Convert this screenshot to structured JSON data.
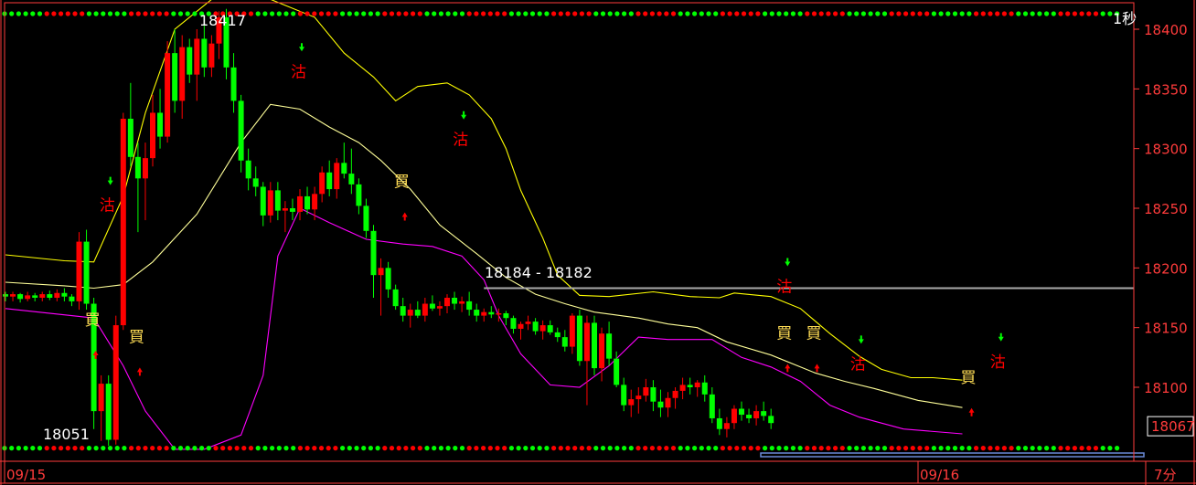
{
  "chart_data": {
    "type": "candlestick",
    "title": "",
    "period_label": "7分",
    "corner_label": "1秒",
    "y_ticks": [
      18400,
      18350,
      18300,
      18250,
      18200,
      18150,
      18100
    ],
    "ylim": [
      18045,
      18430
    ],
    "date_labels": [
      {
        "label": "09/15",
        "index": 0
      },
      {
        "label": "09/16",
        "index": 96
      }
    ],
    "current_price": "18067",
    "high_label": "18417",
    "low_label": "18051",
    "range_label": "18184 - 18182",
    "range_level": 18183,
    "top_dotted_level": 18413,
    "bottom_dotted_level": 18049,
    "colors": {
      "up": "#ff0000",
      "down": "#00ff00",
      "axis": "#ff3b3b",
      "upper_band": "#ffff00",
      "middle_band": "#ffff99",
      "lower_band": "#ff00ff",
      "hline": "#aaaaaa",
      "bottom_bar": "#6a8ad8"
    },
    "candles": [
      [
        18178,
        18180,
        18172,
        18176
      ],
      [
        18176,
        18180,
        18172,
        18178
      ],
      [
        18178,
        18179,
        18171,
        18174
      ],
      [
        18174,
        18180,
        18172,
        18177
      ],
      [
        18177,
        18179,
        18172,
        18175
      ],
      [
        18175,
        18180,
        18172,
        18178
      ],
      [
        18178,
        18181,
        18173,
        18175
      ],
      [
        18175,
        18182,
        18172,
        18179
      ],
      [
        18179,
        18183,
        18172,
        18176
      ],
      [
        18176,
        18178,
        18168,
        18172
      ],
      [
        18172,
        18230,
        18165,
        18222
      ],
      [
        18222,
        18232,
        18165,
        18170
      ],
      [
        18170,
        18175,
        18065,
        18080
      ],
      [
        18080,
        18110,
        18055,
        18103
      ],
      [
        18103,
        18110,
        18051,
        18056
      ],
      [
        18056,
        18160,
        18052,
        18152
      ],
      [
        18152,
        18330,
        18148,
        18325
      ],
      [
        18325,
        18355,
        18285,
        18293
      ],
      [
        18293,
        18305,
        18230,
        18275
      ],
      [
        18275,
        18305,
        18240,
        18292
      ],
      [
        18292,
        18345,
        18285,
        18330
      ],
      [
        18330,
        18350,
        18300,
        18310
      ],
      [
        18310,
        18390,
        18305,
        18380
      ],
      [
        18380,
        18400,
        18330,
        18340
      ],
      [
        18340,
        18395,
        18325,
        18385
      ],
      [
        18385,
        18392,
        18355,
        18362
      ],
      [
        18362,
        18400,
        18340,
        18392
      ],
      [
        18392,
        18405,
        18360,
        18368
      ],
      [
        18368,
        18395,
        18360,
        18388
      ],
      [
        18388,
        18415,
        18375,
        18410
      ],
      [
        18410,
        18417,
        18358,
        18368
      ],
      [
        18368,
        18380,
        18330,
        18340
      ],
      [
        18340,
        18345,
        18280,
        18290
      ],
      [
        18290,
        18300,
        18265,
        18275
      ],
      [
        18275,
        18285,
        18260,
        18268
      ],
      [
        18268,
        18272,
        18235,
        18244
      ],
      [
        18244,
        18272,
        18238,
        18265
      ],
      [
        18265,
        18272,
        18240,
        18248
      ],
      [
        18248,
        18256,
        18230,
        18250
      ],
      [
        18250,
        18258,
        18240,
        18247
      ],
      [
        18247,
        18266,
        18240,
        18260
      ],
      [
        18260,
        18268,
        18245,
        18249
      ],
      [
        18249,
        18268,
        18240,
        18262
      ],
      [
        18262,
        18285,
        18255,
        18280
      ],
      [
        18280,
        18290,
        18260,
        18266
      ],
      [
        18266,
        18292,
        18258,
        18288
      ],
      [
        18288,
        18305,
        18275,
        18279
      ],
      [
        18279,
        18300,
        18262,
        18270
      ],
      [
        18270,
        18275,
        18245,
        18252
      ],
      [
        18252,
        18258,
        18225,
        18231
      ],
      [
        18231,
        18236,
        18175,
        18194
      ],
      [
        18194,
        18208,
        18160,
        18200
      ],
      [
        18200,
        18205,
        18175,
        18182
      ],
      [
        18182,
        18186,
        18165,
        18168
      ],
      [
        18168,
        18175,
        18155,
        18160
      ],
      [
        18160,
        18170,
        18150,
        18165
      ],
      [
        18165,
        18172,
        18158,
        18160
      ],
      [
        18160,
        18175,
        18155,
        18170
      ],
      [
        18170,
        18177,
        18164,
        18166
      ],
      [
        18166,
        18172,
        18160,
        18168
      ],
      [
        18168,
        18178,
        18162,
        18175
      ],
      [
        18175,
        18180,
        18165,
        18170
      ],
      [
        18170,
        18176,
        18163,
        18172
      ],
      [
        18172,
        18180,
        18160,
        18165
      ],
      [
        18165,
        18170,
        18155,
        18160
      ],
      [
        18160,
        18166,
        18155,
        18163
      ],
      [
        18163,
        18168,
        18158,
        18161
      ],
      [
        18161,
        18166,
        18155,
        18162
      ],
      [
        18162,
        18164,
        18152,
        18158
      ],
      [
        18158,
        18160,
        18145,
        18149
      ],
      [
        18149,
        18155,
        18140,
        18153
      ],
      [
        18153,
        18160,
        18148,
        18155
      ],
      [
        18155,
        18158,
        18144,
        18147
      ],
      [
        18147,
        18156,
        18140,
        18152
      ],
      [
        18152,
        18156,
        18144,
        18146
      ],
      [
        18146,
        18150,
        18138,
        18142
      ],
      [
        18142,
        18148,
        18130,
        18134
      ],
      [
        18134,
        18162,
        18128,
        18160
      ],
      [
        18160,
        18165,
        18118,
        18122
      ],
      [
        18122,
        18160,
        18085,
        18154
      ],
      [
        18154,
        18160,
        18110,
        18116
      ],
      [
        18116,
        18150,
        18105,
        18145
      ],
      [
        18145,
        18155,
        18118,
        18124
      ],
      [
        18124,
        18130,
        18100,
        18102
      ],
      [
        18102,
        18108,
        18080,
        18085
      ],
      [
        18085,
        18098,
        18075,
        18090
      ],
      [
        18090,
        18100,
        18078,
        18093
      ],
      [
        18093,
        18107,
        18088,
        18100
      ],
      [
        18100,
        18106,
        18080,
        18088
      ],
      [
        18088,
        18098,
        18075,
        18083
      ],
      [
        18083,
        18096,
        18075,
        18091
      ],
      [
        18091,
        18100,
        18082,
        18097
      ],
      [
        18097,
        18108,
        18090,
        18102
      ],
      [
        18102,
        18108,
        18094,
        18100
      ],
      [
        18100,
        18106,
        18092,
        18104
      ],
      [
        18104,
        18110,
        18088,
        18094
      ],
      [
        18094,
        18100,
        18070,
        18074
      ],
      [
        18074,
        18082,
        18060,
        18065
      ],
      [
        18065,
        18075,
        18058,
        18070
      ],
      [
        18070,
        18085,
        18065,
        18082
      ],
      [
        18082,
        18088,
        18072,
        18077
      ],
      [
        18077,
        18082,
        18070,
        18074
      ],
      [
        18074,
        18085,
        18068,
        18080
      ],
      [
        18080,
        18088,
        18072,
        18076
      ],
      [
        18076,
        18082,
        18065,
        18070
      ]
    ],
    "bands": {
      "upper": [
        [
          0,
          18211
        ],
        [
          8,
          18206
        ],
        [
          12,
          18205
        ],
        [
          16,
          18260
        ],
        [
          19,
          18330
        ],
        [
          23,
          18400
        ],
        [
          29,
          18430
        ],
        [
          36,
          18425
        ],
        [
          42,
          18410
        ],
        [
          46,
          18380
        ],
        [
          50,
          18360
        ],
        [
          53,
          18340
        ],
        [
          56,
          18352
        ],
        [
          60,
          18355
        ],
        [
          63,
          18345
        ],
        [
          66,
          18325
        ],
        [
          68,
          18300
        ],
        [
          70,
          18265
        ],
        [
          73,
          18225
        ],
        [
          75,
          18194
        ],
        [
          78,
          18177
        ],
        [
          82,
          18176
        ],
        [
          88,
          18180
        ],
        [
          93,
          18176
        ],
        [
          97,
          18175
        ],
        [
          99,
          18179
        ],
        [
          104,
          18176
        ],
        [
          108,
          18166
        ],
        [
          112,
          18145
        ],
        [
          116,
          18126
        ],
        [
          119,
          18115
        ],
        [
          123,
          18108
        ],
        [
          126,
          18108
        ],
        [
          130,
          18106
        ]
      ],
      "middle": [
        [
          0,
          18188
        ],
        [
          8,
          18185
        ],
        [
          12,
          18183
        ],
        [
          16,
          18186
        ],
        [
          20,
          18205
        ],
        [
          26,
          18245
        ],
        [
          32,
          18305
        ],
        [
          36,
          18337
        ],
        [
          40,
          18333
        ],
        [
          44,
          18318
        ],
        [
          48,
          18305
        ],
        [
          51,
          18290
        ],
        [
          55,
          18266
        ],
        [
          59,
          18236
        ],
        [
          64,
          18212
        ],
        [
          68,
          18192
        ],
        [
          72,
          18178
        ],
        [
          76,
          18170
        ],
        [
          80,
          18163
        ],
        [
          86,
          18158
        ],
        [
          90,
          18153
        ],
        [
          94,
          18150
        ],
        [
          98,
          18138
        ],
        [
          104,
          18127
        ],
        [
          110,
          18112
        ],
        [
          114,
          18105
        ],
        [
          118,
          18099
        ],
        [
          124,
          18089
        ],
        [
          130,
          18083
        ]
      ],
      "lower": [
        [
          0,
          18166
        ],
        [
          12,
          18158
        ],
        [
          16,
          18118
        ],
        [
          19,
          18080
        ],
        [
          23,
          18048
        ],
        [
          27,
          18048
        ],
        [
          32,
          18060
        ],
        [
          35,
          18110
        ],
        [
          37,
          18210
        ],
        [
          40,
          18250
        ],
        [
          44,
          18238
        ],
        [
          49,
          18224
        ],
        [
          54,
          18220
        ],
        [
          58,
          18218
        ],
        [
          62,
          18210
        ],
        [
          65,
          18190
        ],
        [
          67,
          18160
        ],
        [
          70,
          18128
        ],
        [
          74,
          18102
        ],
        [
          78,
          18100
        ],
        [
          82,
          18118
        ],
        [
          86,
          18142
        ],
        [
          90,
          18140
        ],
        [
          96,
          18140
        ],
        [
          100,
          18125
        ],
        [
          104,
          18117
        ],
        [
          108,
          18105
        ],
        [
          112,
          18085
        ],
        [
          116,
          18075
        ],
        [
          122,
          18065
        ],
        [
          130,
          18061
        ]
      ]
    },
    "signals": [
      {
        "label": "沽",
        "index": 14,
        "price": 18248,
        "color": "#ff0000"
      },
      {
        "label": "買",
        "index": 12,
        "price": 18152,
        "color": "#ffdd55"
      },
      {
        "label": "買",
        "index": 18,
        "price": 18138,
        "color": "#ffdd55"
      },
      {
        "label": "沽",
        "index": 40,
        "price": 18360,
        "color": "#ff0000"
      },
      {
        "label": "買",
        "index": 54,
        "price": 18268,
        "color": "#ffdd55"
      },
      {
        "label": "沽",
        "index": 62,
        "price": 18303,
        "color": "#ff0000"
      },
      {
        "label": "沽",
        "index": 106,
        "price": 18180,
        "color": "#ff0000"
      },
      {
        "label": "買",
        "index": 106,
        "price": 18141,
        "color": "#ffdd55"
      },
      {
        "label": "買",
        "index": 110,
        "price": 18141,
        "color": "#ffdd55"
      },
      {
        "label": "沽",
        "index": 116,
        "price": 18115,
        "color": "#ff0000"
      },
      {
        "label": "買",
        "index": 131,
        "price": 18104,
        "color": "#ffdd55"
      },
      {
        "label": "沽",
        "index": 135,
        "price": 18117,
        "color": "#ff0000"
      }
    ]
  }
}
